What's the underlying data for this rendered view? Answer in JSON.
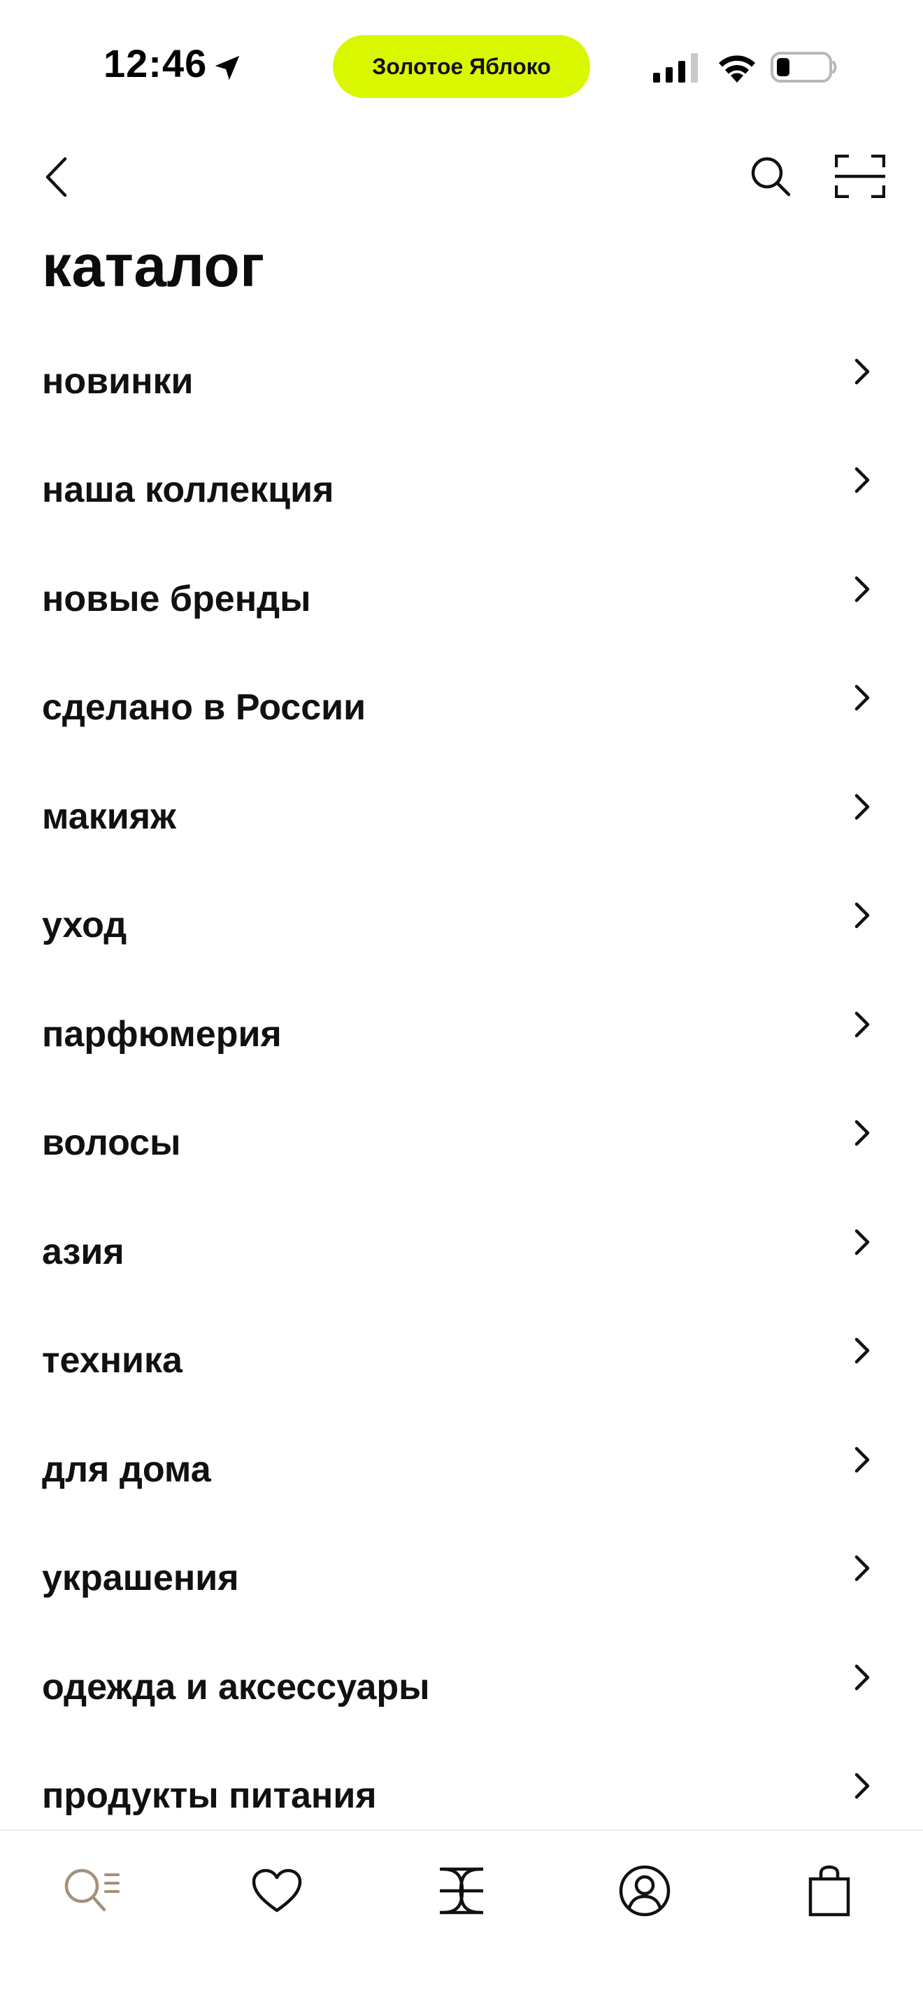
{
  "status_bar": {
    "time": "12:46",
    "pill_label": "Золотое Яблоко",
    "pill_color": "#d9f800"
  },
  "header": {
    "title": "каталог",
    "icons": [
      "back-arrow",
      "search",
      "scan"
    ]
  },
  "catalog": {
    "items": [
      {
        "label": "новинки"
      },
      {
        "label": "наша коллекция"
      },
      {
        "label": "новые бренды"
      },
      {
        "label": "сделано в России"
      },
      {
        "label": "макияж"
      },
      {
        "label": "уход"
      },
      {
        "label": "парфюмерия"
      },
      {
        "label": "волосы"
      },
      {
        "label": "азия"
      },
      {
        "label": "техника"
      },
      {
        "label": "для дома"
      },
      {
        "label": "украшения"
      },
      {
        "label": "одежда и аксессуары"
      },
      {
        "label": "продукты питания"
      }
    ]
  },
  "tab_bar": {
    "active_tab": "catalog",
    "active_color": "#a4907c",
    "tabs": [
      "catalog",
      "favorites",
      "home",
      "profile",
      "cart"
    ]
  }
}
